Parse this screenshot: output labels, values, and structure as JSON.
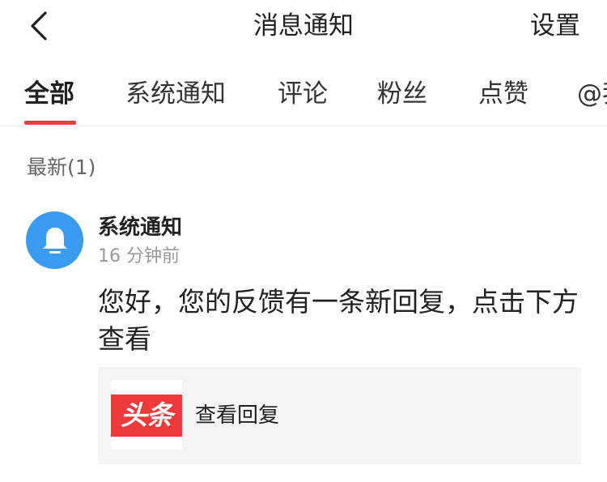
{
  "header": {
    "title": "消息通知",
    "settings_label": "设置",
    "back_icon": "chevron-left-icon"
  },
  "tabs": [
    {
      "label": "全部",
      "active": true
    },
    {
      "label": "系统通知",
      "active": false
    },
    {
      "label": "评论",
      "active": false
    },
    {
      "label": "粉丝",
      "active": false
    },
    {
      "label": "点赞",
      "active": false
    },
    {
      "label": "@我",
      "active": false
    }
  ],
  "section": {
    "label": "最新(1)"
  },
  "notification": {
    "sender": "系统通知",
    "time": "16 分钟前",
    "message": "您好，您的反馈有一条新回复，点击下方查看",
    "avatar_icon": "bell-icon",
    "card": {
      "logo_text": "头条",
      "action_text": "查看回复"
    }
  },
  "colors": {
    "accent": "#e8403c",
    "avatar_bg": "#3a9cf0",
    "logo_bg": "#ee3a3a",
    "card_bg": "#f5f5f5"
  }
}
